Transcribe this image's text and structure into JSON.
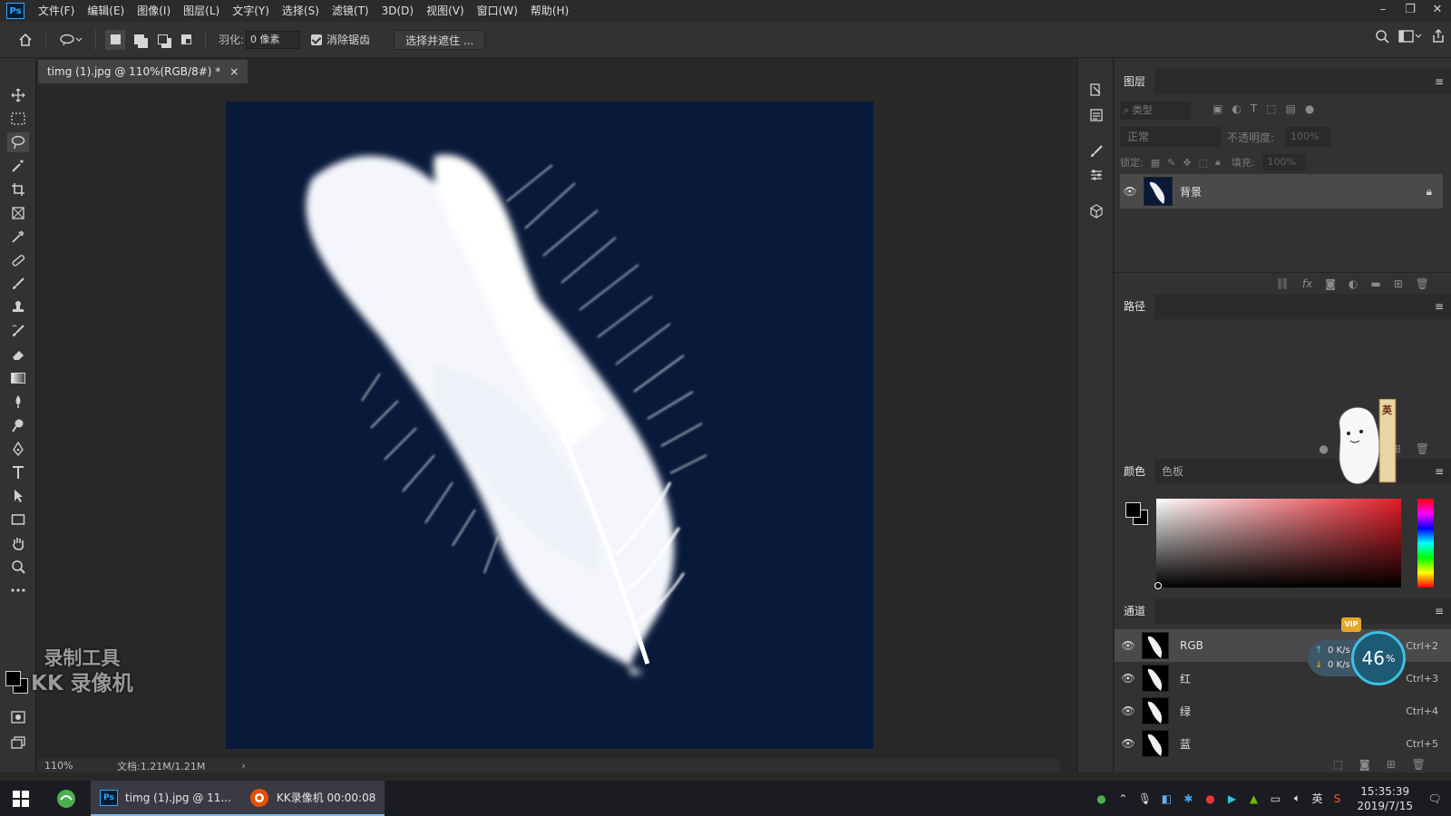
{
  "app": {
    "logo": "Ps"
  },
  "menu": [
    "文件(F)",
    "编辑(E)",
    "图像(I)",
    "图层(L)",
    "文字(Y)",
    "选择(S)",
    "滤镜(T)",
    "3D(D)",
    "视图(V)",
    "窗口(W)",
    "帮助(H)"
  ],
  "window_controls": {
    "minimize": "–",
    "restore": "❐",
    "close": "✕"
  },
  "options": {
    "feather_label": "羽化:",
    "feather_value": "0 像素",
    "antialias_label": "消除锯齿",
    "select_mask_button": "选择并遮住 ..."
  },
  "document": {
    "tab_title": "timg (1).jpg @ 110%(RGB/8#) *",
    "tab_close": "×",
    "canvas_color": "#08193a"
  },
  "status": {
    "zoom": "110%",
    "doc_size": "文档:1.21M/1.21M",
    "arrow": "›"
  },
  "watermark": {
    "line1": "录制工具",
    "line2": "KK 录像机"
  },
  "layers_panel": {
    "tab": "图层",
    "filter_placeholder": "类型",
    "blend_mode": "正常",
    "opacity_label": "不透明度:",
    "opacity_value": "100%",
    "lock_label": "锁定:",
    "fill_label": "填充:",
    "fill_value": "100%",
    "layers": [
      {
        "name": "背景",
        "locked": true,
        "visible": true
      }
    ]
  },
  "paths_panel": {
    "tab": "路径"
  },
  "color_panel": {
    "tab_color": "颜色",
    "tab_swatches": "色板",
    "picker_hue": "#e21d27"
  },
  "channels_panel": {
    "tab": "通道",
    "channels": [
      {
        "name": "RGB",
        "shortcut": "Ctrl+2"
      },
      {
        "name": "红",
        "shortcut": "Ctrl+3"
      },
      {
        "name": "绿",
        "shortcut": "Ctrl+4"
      },
      {
        "name": "蓝",
        "shortcut": "Ctrl+5"
      }
    ]
  },
  "net_monitor": {
    "up": "0 K/s",
    "down": "0 K/s",
    "percent": "46",
    "percent_sign": "%",
    "vip": "VIP"
  },
  "mascot_sign": "英",
  "taskbar": {
    "ps_window": "timg (1).jpg @ 11...",
    "recorder": "KK录像机 00:00:08",
    "ime": "英",
    "time": "15:35:39",
    "date": "2019/7/15"
  }
}
